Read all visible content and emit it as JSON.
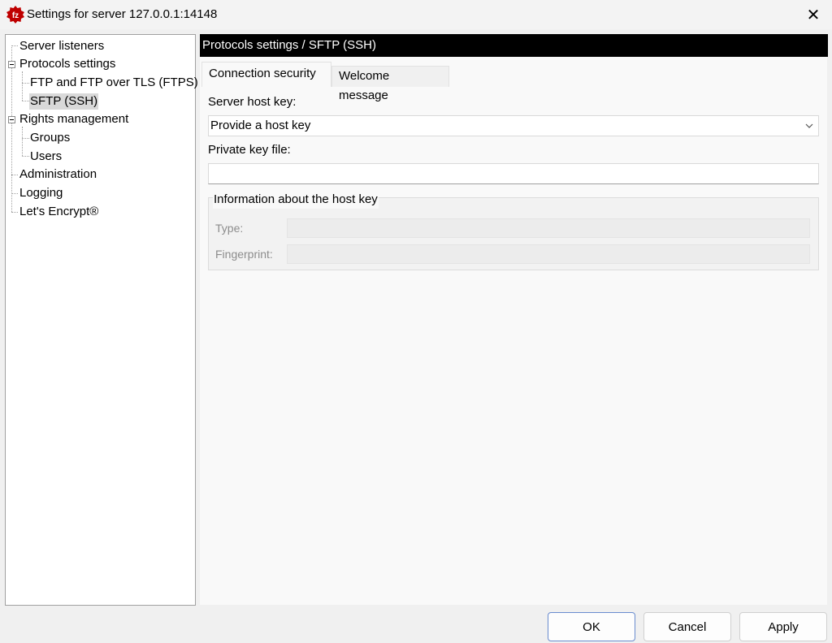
{
  "window": {
    "title": "Settings for server 127.0.0.1:14148",
    "close_glyph": "✕"
  },
  "tree": {
    "items": [
      {
        "label": "Server listeners"
      },
      {
        "label": "Protocols settings"
      },
      {
        "label": "FTP and FTP over TLS (FTPS)"
      },
      {
        "label": "SFTP (SSH)"
      },
      {
        "label": "Rights management"
      },
      {
        "label": "Groups"
      },
      {
        "label": "Users"
      },
      {
        "label": "Administration"
      },
      {
        "label": "Logging"
      },
      {
        "label": "Let's Encrypt®"
      }
    ],
    "selected": "SFTP (SSH)"
  },
  "panel": {
    "header": "Protocols settings / SFTP (SSH)",
    "tabs": [
      {
        "label": "Connection security",
        "active": true
      },
      {
        "label": "Welcome message",
        "active": false
      }
    ],
    "server_host_key_label": "Server host key:",
    "server_host_key_value": "Provide a host key",
    "private_key_file_label": "Private key file:",
    "private_key_file_value": "",
    "host_key_group_title": "Information about the host key",
    "type_label": "Type:",
    "type_value": "",
    "fingerprint_label": "Fingerprint:",
    "fingerprint_value": ""
  },
  "buttons": {
    "ok": "OK",
    "cancel": "Cancel",
    "apply": "Apply"
  },
  "colors": {
    "header_bg": "#000000",
    "header_fg": "#ffffff",
    "default_button_border": "#6a8ccf"
  }
}
